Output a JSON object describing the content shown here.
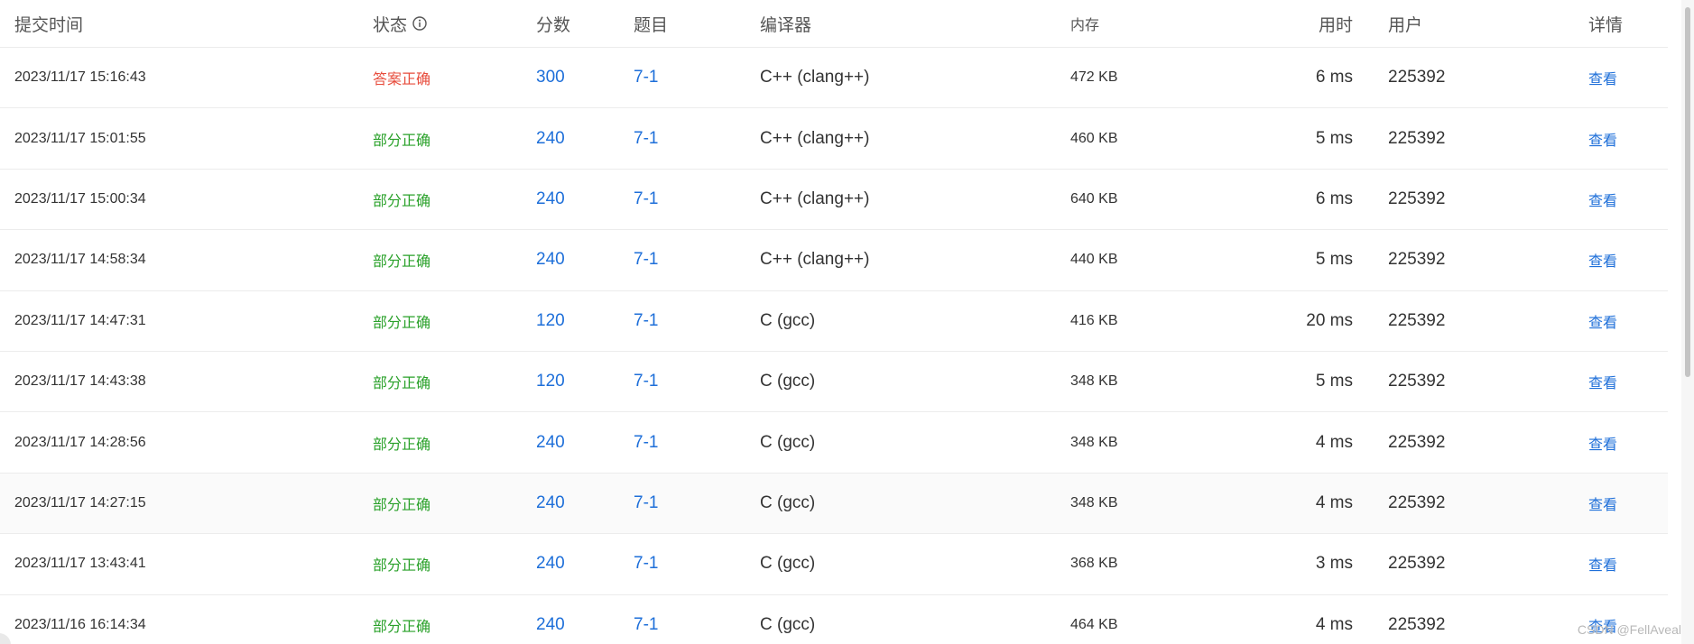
{
  "columns": {
    "time": "提交时间",
    "status": "状态",
    "score": "分数",
    "problem": "题目",
    "compiler": "编译器",
    "memory": "内存",
    "runtime": "用时",
    "user": "用户",
    "detail": "详情"
  },
  "icons": {
    "status_info": "info-circle-icon"
  },
  "colors": {
    "accepted": "#e74c3c",
    "partial": "#2aa12a",
    "link": "#1e6fd9"
  },
  "rows": [
    {
      "time": "2023/11/17 15:16:43",
      "status": "答案正确",
      "status_type": "ac",
      "score": "300",
      "problem": "7-1",
      "compiler": "C++ (clang++)",
      "memory": "472 KB",
      "runtime": "6 ms",
      "user": "225392",
      "detail": "查看"
    },
    {
      "time": "2023/11/17 15:01:55",
      "status": "部分正确",
      "status_type": "pa",
      "score": "240",
      "problem": "7-1",
      "compiler": "C++ (clang++)",
      "memory": "460 KB",
      "runtime": "5 ms",
      "user": "225392",
      "detail": "查看"
    },
    {
      "time": "2023/11/17 15:00:34",
      "status": "部分正确",
      "status_type": "pa",
      "score": "240",
      "problem": "7-1",
      "compiler": "C++ (clang++)",
      "memory": "640 KB",
      "runtime": "6 ms",
      "user": "225392",
      "detail": "查看"
    },
    {
      "time": "2023/11/17 14:58:34",
      "status": "部分正确",
      "status_type": "pa",
      "score": "240",
      "problem": "7-1",
      "compiler": "C++ (clang++)",
      "memory": "440 KB",
      "runtime": "5 ms",
      "user": "225392",
      "detail": "查看"
    },
    {
      "time": "2023/11/17 14:47:31",
      "status": "部分正确",
      "status_type": "pa",
      "score": "120",
      "problem": "7-1",
      "compiler": "C (gcc)",
      "memory": "416 KB",
      "runtime": "20 ms",
      "user": "225392",
      "detail": "查看"
    },
    {
      "time": "2023/11/17 14:43:38",
      "status": "部分正确",
      "status_type": "pa",
      "score": "120",
      "problem": "7-1",
      "compiler": "C (gcc)",
      "memory": "348 KB",
      "runtime": "5 ms",
      "user": "225392",
      "detail": "查看"
    },
    {
      "time": "2023/11/17 14:28:56",
      "status": "部分正确",
      "status_type": "pa",
      "score": "240",
      "problem": "7-1",
      "compiler": "C (gcc)",
      "memory": "348 KB",
      "runtime": "4 ms",
      "user": "225392",
      "detail": "查看"
    },
    {
      "time": "2023/11/17 14:27:15",
      "status": "部分正确",
      "status_type": "pa",
      "score": "240",
      "problem": "7-1",
      "compiler": "C (gcc)",
      "memory": "348 KB",
      "runtime": "4 ms",
      "user": "225392",
      "detail": "查看"
    },
    {
      "time": "2023/11/17 13:43:41",
      "status": "部分正确",
      "status_type": "pa",
      "score": "240",
      "problem": "7-1",
      "compiler": "C (gcc)",
      "memory": "368 KB",
      "runtime": "3 ms",
      "user": "225392",
      "detail": "查看"
    },
    {
      "time": "2023/11/16 16:14:34",
      "status": "部分正确",
      "status_type": "pa",
      "score": "240",
      "problem": "7-1",
      "compiler": "C (gcc)",
      "memory": "464 KB",
      "runtime": "4 ms",
      "user": "225392",
      "detail": "查看"
    }
  ],
  "watermark": "CSDN @FellAveal"
}
